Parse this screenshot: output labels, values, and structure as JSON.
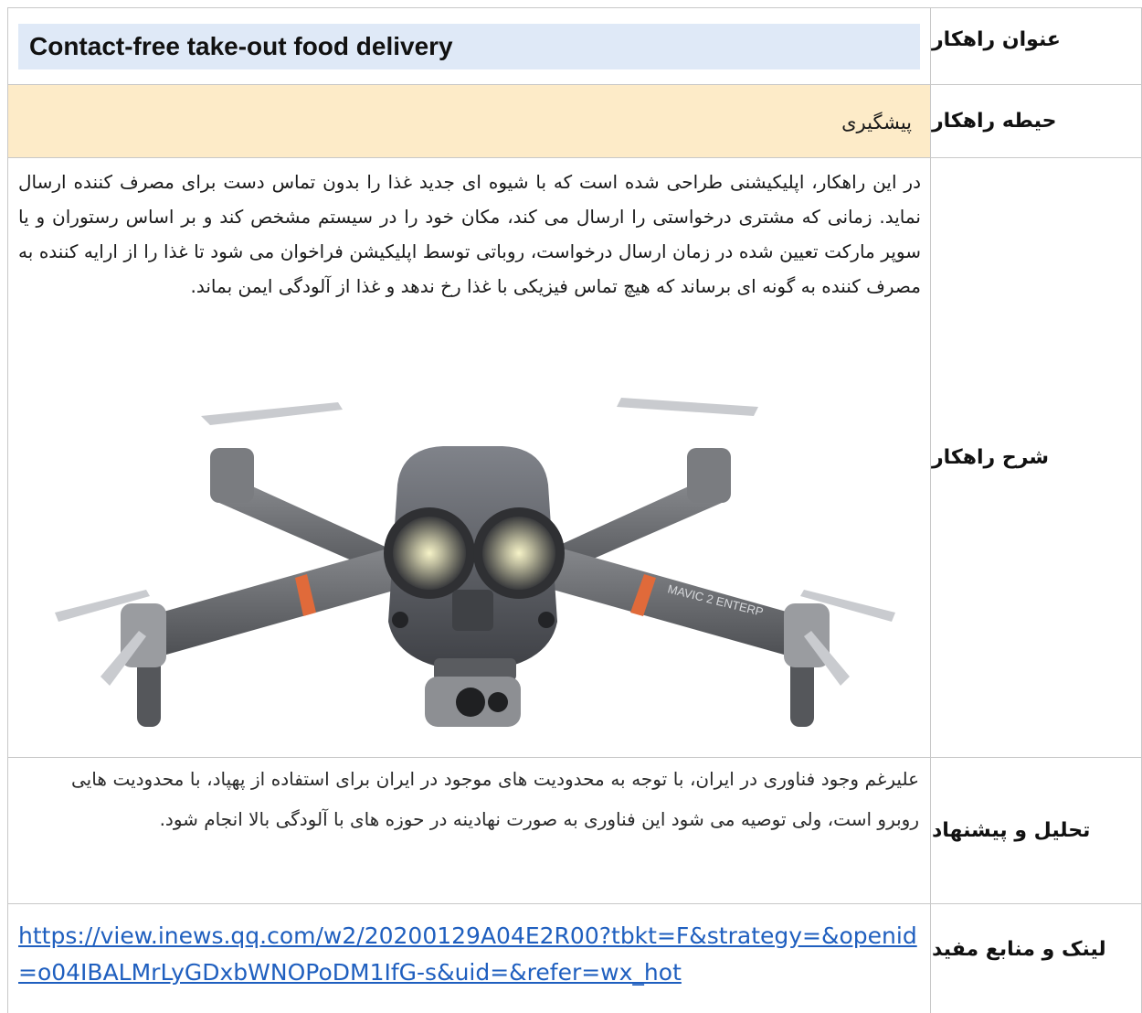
{
  "labels": {
    "title": "عنوان راهکار",
    "scope": "حیطه راهکار",
    "description": "شرح راهکار",
    "analysis": "تحلیل و پیشنهاد",
    "links": "لینک و منابع مفید"
  },
  "title_value": "Contact-free take-out food delivery",
  "scope_value": "پیشگیری",
  "description_text": "در این راهکار، اپلیکیشنی طراحی شده است که با شیوه ای جدید غذا را بدون  تماس دست برای مصرف کننده ارسال نماید. زمانی که مشتری درخواستی را ارسال می کند، مکان خود را در سیستم مشخص کند و بر اساس رستوران و یا سوپر مارکت تعیین شده در زمان ارسال درخواست، روباتی توسط اپلیکیشن فراخوان می شود تا غذا را از ارایه کننده به مصرف کننده به گونه ای برساند که هیچ تماس فیزیکی با غذا رخ ندهد و غذا از آلودگی ایمن بماند.",
  "image": {
    "icon": "drone-image",
    "brand_text": "MAVIC 2 ENTERP"
  },
  "analysis_text": "علیرغم وجود فناوری در ایران، با توجه به محدودیت های موجود در ایران برای استفاده از پهپاد، با محدودیت هایی روبرو است، ولی توصیه می شود این فناوری به صورت نهادینه در حوزه های با آلودگی بالا انجام شود.",
  "link_text": "https://view.inews.qq.com/w2/20200129A04E2R00?tbkt=F&strategy=&openid=o04IBALMrLyGDxbWNOPoDM1IfG-s&uid=&refer=wx_hot",
  "colors": {
    "title_bg": "#dfe9f7",
    "scope_bg": "#fdebc8",
    "link": "#1f5fbf",
    "border": "#c8c8c8"
  }
}
